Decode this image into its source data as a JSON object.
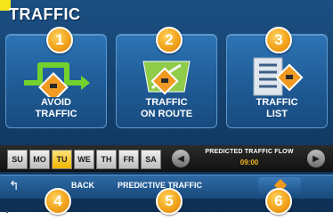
{
  "header": {
    "title": "TRAFFIC"
  },
  "tiles": [
    {
      "label": "AVOID\nTRAFFIC",
      "badge": "1",
      "icon": "avoid-traffic-detour-icon"
    },
    {
      "label": "TRAFFIC\nON ROUTE",
      "badge": "2",
      "icon": "traffic-on-route-map-icon"
    },
    {
      "label": "TRAFFIC\nLIST",
      "badge": "3",
      "icon": "traffic-list-icon"
    }
  ],
  "days": [
    "SU",
    "MO",
    "TU",
    "WE",
    "TH",
    "FR",
    "SA"
  ],
  "selected_day": "TU",
  "predicted_flow": {
    "label": "PREDICTED TRAFFIC FLOW",
    "time": "09:00"
  },
  "bottom": {
    "back_label": "BACK",
    "predict_label": "PREDICTIVE TRAFFIC",
    "badges": [
      "4",
      "5",
      "6"
    ]
  },
  "colors": {
    "accent": "#f2a31b",
    "warning": "#f19a22",
    "screen_bg": "#123c66"
  }
}
